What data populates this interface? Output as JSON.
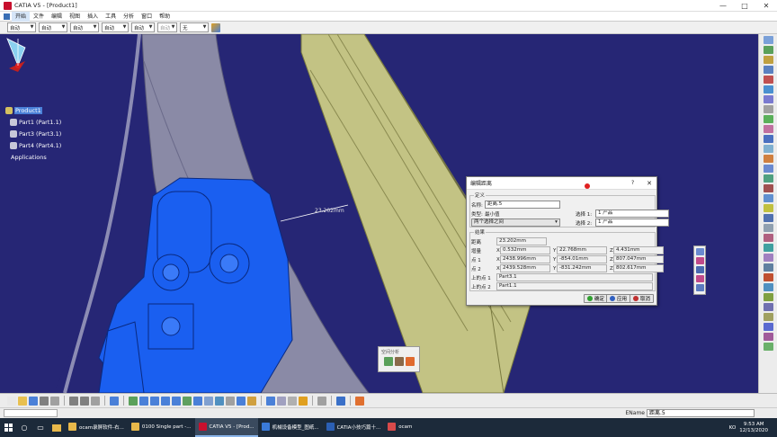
{
  "window": {
    "title": "CATIA V5 - [Product1]",
    "controls": [
      "—",
      "□",
      "✕"
    ]
  },
  "menu": {
    "items": [
      "开始",
      "文件",
      "编辑",
      "视图",
      "插入",
      "工具",
      "分析",
      "窗口",
      "帮助"
    ]
  },
  "property_toolbar": {
    "combos": [
      "自动",
      "自动",
      "自动",
      "自动",
      "自动",
      "自动",
      "无"
    ]
  },
  "tree": {
    "root": "Product1",
    "children": [
      "Part1 (Part1.1)",
      "Part3 (Part3.1)",
      "Part4 (Part4.1)"
    ],
    "applications": "Applications"
  },
  "viewport": {
    "distance_label": "23.202mm"
  },
  "dialog": {
    "title": "编辑距离",
    "help": "?",
    "close": "✕",
    "definition_group": "定义",
    "name_label": "名称:",
    "name_value": "距离.5",
    "type_label": "类型:",
    "type_value": "最小值",
    "mode_value": "两个选择之间",
    "selection1_label": "选择 1:",
    "selection1_value": "1 产品",
    "selection2_label": "选择 2:",
    "selection2_value": "1 产品",
    "results_group": "结果",
    "distance_label": "距离",
    "distance_value": "23.202mm",
    "delta_label": "增量",
    "delta_x": "0.532mm",
    "delta_y": "22.768mm",
    "delta_z": "4.431mm",
    "point1_label": "点 1",
    "point1_x": "2438.996mm",
    "point1_y": "-854.01mm",
    "point1_z": "807.047mm",
    "point2_label": "点 2",
    "point2_x": "2439.528mm",
    "point2_y": "-831.242mm",
    "point2_z": "802.617mm",
    "x_prefix": "X",
    "y_prefix": "Y",
    "z_prefix": "Z",
    "on1_label": "上的点 1",
    "on1_value": "Part3.1",
    "on2_label": "上的点 2",
    "on2_value": "Part1.1",
    "ok_button": "确定",
    "apply_button": "应用",
    "cancel_button": "取消"
  },
  "analysis_toolbar": {
    "title": "空间分析"
  },
  "statusbar": {
    "ename_label": "EName",
    "ename_value": "距离.5"
  },
  "taskbar": {
    "apps": [
      {
        "label": "ocam录屏软件-右...",
        "color": "#e8b84a"
      },
      {
        "label": "0100 Single part -...",
        "color": "#e8b84a"
      },
      {
        "label": "CATIA V5 - [Prod...",
        "color": "#c8102e"
      },
      {
        "label": "机械设备模型_图纸...",
        "color": "#3a7ad8"
      },
      {
        "label": "CATIA小技巧篇十...",
        "color": "#2b5fb4"
      },
      {
        "label": "ocam",
        "color": "#d84a4a"
      }
    ],
    "tray": "KO",
    "time": "9:53 AM",
    "date": "12/13/2020"
  },
  "colors": {
    "background": "#262675",
    "part_blue": "#1a5ff0",
    "beam_green": "#c8c88a"
  }
}
